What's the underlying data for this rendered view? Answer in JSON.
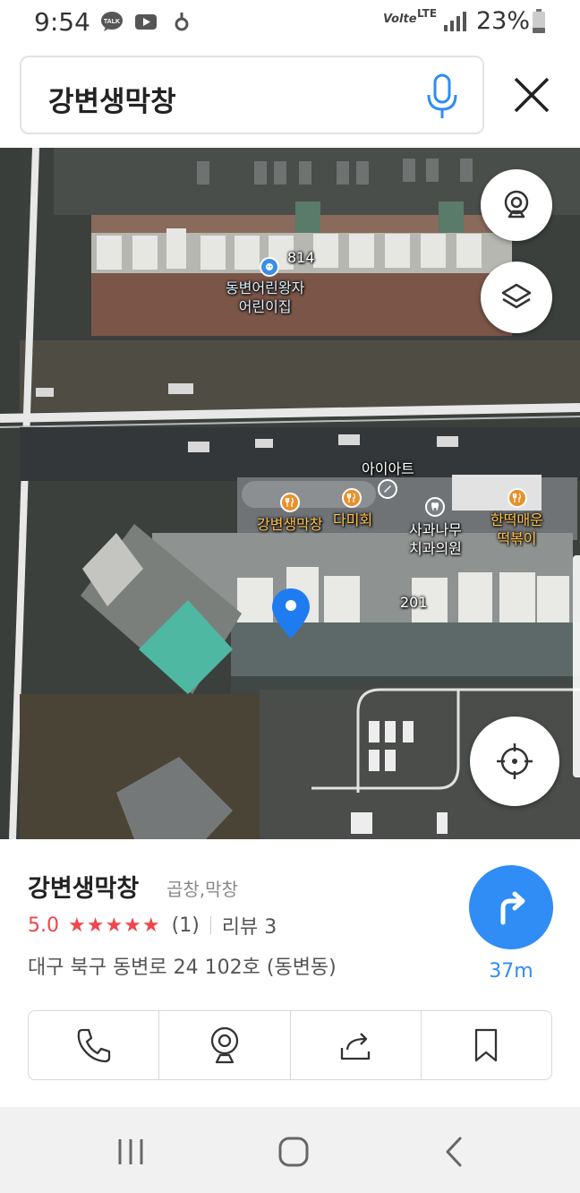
{
  "status_bar": {
    "time": "9:54",
    "notification_icons": [
      "talk-icon",
      "youtube-icon",
      "thumb-icon"
    ],
    "volte": "Volte",
    "network": "LTE",
    "battery": "23%"
  },
  "search": {
    "query": "강변생막창"
  },
  "map": {
    "labels": [
      {
        "text": "814"
      },
      {
        "text": "동변어린왕자\n어린이집"
      },
      {
        "text": "아이아트"
      },
      {
        "text": "강변생막창"
      },
      {
        "text": "다미회"
      },
      {
        "text": "사과나무\n치과의원"
      },
      {
        "text": "한떡매운\n떡볶이"
      },
      {
        "text": "201"
      }
    ]
  },
  "place": {
    "name": "강변생막창",
    "category": "곱창,막창",
    "rating": "5.0",
    "stars": "★★★★★",
    "rating_count": "(1)",
    "review_label": "리뷰 3",
    "address": "대구 북구 동변로 24 102호 (동변동)",
    "distance": "37m"
  },
  "colors": {
    "accent": "#2f8df5",
    "rating": "#f0454b",
    "poi_food": "#e8902a"
  }
}
